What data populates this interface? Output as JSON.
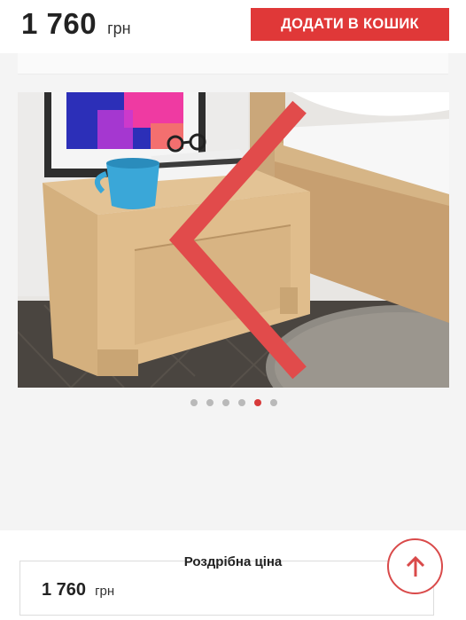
{
  "header": {
    "price_value": "1 760",
    "price_currency": "грн",
    "add_to_cart_label": "ДОДАТИ В КОШИК"
  },
  "gallery": {
    "slide_count": 6,
    "active_index": 4,
    "prev_icon": "chevron-left-icon",
    "next_icon": "chevron-right-icon"
  },
  "retail": {
    "label": "Роздрібна ціна",
    "price_value": "1 760",
    "price_currency": "грн"
  },
  "scroll_top": {
    "icon": "arrow-up-icon"
  },
  "colors": {
    "accent": "#e03838",
    "active_dot": "#d73a3a",
    "inactive_dot": "#b9b9b9"
  }
}
